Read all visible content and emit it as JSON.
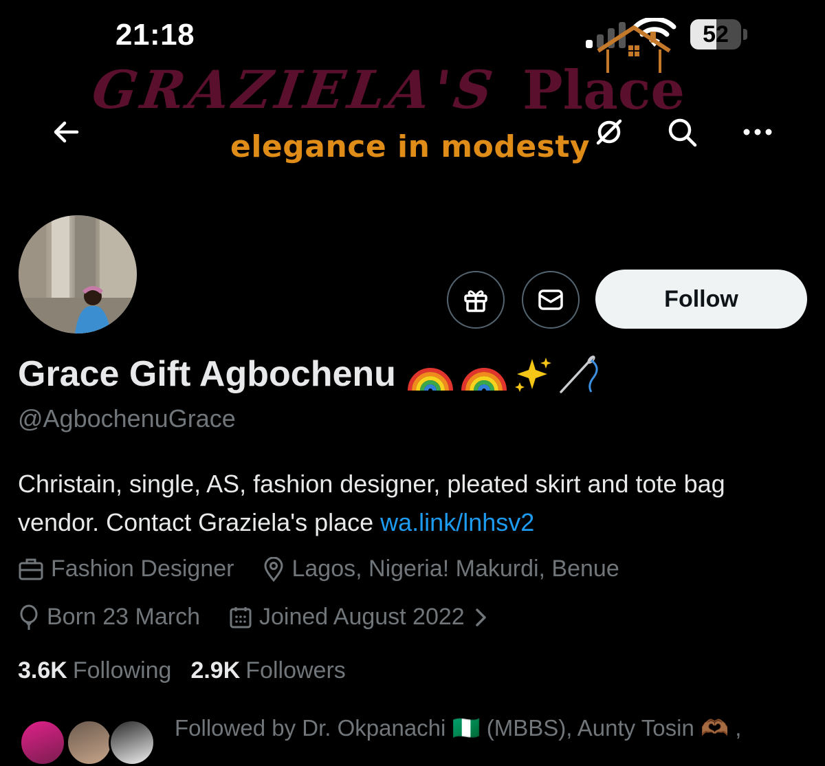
{
  "status_bar": {
    "time": "21:18",
    "battery": "52",
    "battery_level": 0.52
  },
  "banner": {
    "brand_script": "GRAZIELA'S",
    "brand_word": "Place",
    "tagline": "elegance in modesty",
    "colors": {
      "brand": "#5a0f2c",
      "tagline": "#e08c18"
    }
  },
  "nav": {
    "back_icon": "arrow-left-icon",
    "noentry_icon": "no-entry-icon",
    "search_icon": "search-icon",
    "more_icon": "more-horizontal-icon"
  },
  "profile": {
    "display_name": "Grace Gift Agbochenu",
    "name_emojis": [
      "🌈",
      "🌈",
      "✨",
      "🪡"
    ],
    "handle": "@AgbochenuGrace",
    "bio_text": "Christain, single, AS, fashion designer, pleated skirt and tote bag vendor. Contact Graziela's place ",
    "bio_link": "wa.link/lnhsv2",
    "profession": "Fashion Designer",
    "location": "Lagos, Nigeria! Makurdi, Benue",
    "birthday": "Born 23 March",
    "joined": "Joined August 2022",
    "following_count": "3.6K",
    "following_label": "Following",
    "followers_count": "2.9K",
    "followers_label": "Followers",
    "followed_by": "Followed by Dr. Okpanachi 🇳🇬 (MBBS), Aunty Tosin 🫶🏾 ,"
  },
  "actions": {
    "follow_label": "Follow",
    "gift_icon": "gift-icon",
    "message_icon": "envelope-icon"
  },
  "colors": {
    "accent_link": "#1d9bf0",
    "muted": "#71767b",
    "text": "#e7e9ea",
    "background": "#000000"
  }
}
